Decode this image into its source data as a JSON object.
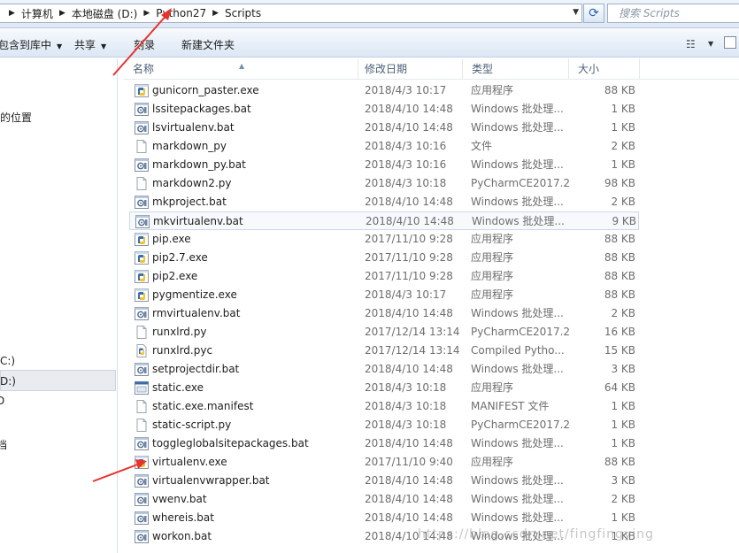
{
  "address": {
    "crumbs": [
      "计算机",
      "本地磁盘 (D:)",
      "Python27",
      "Scripts"
    ]
  },
  "search": {
    "placeholder": "搜索 Scripts"
  },
  "toolbar": {
    "include_library": "包含到库中",
    "share": "共享",
    "burn": "刻录",
    "new_folder": "新建文件夹"
  },
  "nav": {
    "items": [
      "的位置",
      "C:)",
      "D:)",
      "D",
      "档"
    ]
  },
  "columns": {
    "name": "名称",
    "date": "修改日期",
    "type": "类型",
    "size": "大小"
  },
  "files": [
    {
      "name": "gunicorn_paster.exe",
      "date": "2018/4/3 10:17",
      "type": "应用程序",
      "size": "88 KB",
      "icon": "python-exe-icon"
    },
    {
      "name": "lssitepackages.bat",
      "date": "2018/4/10 14:48",
      "type": "Windows 批处理...",
      "size": "1 KB",
      "icon": "bat-icon"
    },
    {
      "name": "lsvirtualenv.bat",
      "date": "2018/4/10 14:48",
      "type": "Windows 批处理...",
      "size": "1 KB",
      "icon": "bat-icon"
    },
    {
      "name": "markdown_py",
      "date": "2018/4/3 10:16",
      "type": "文件",
      "size": "2 KB",
      "icon": "blank-file-icon"
    },
    {
      "name": "markdown_py.bat",
      "date": "2018/4/3 10:16",
      "type": "Windows 批处理...",
      "size": "1 KB",
      "icon": "bat-icon"
    },
    {
      "name": "markdown2.py",
      "date": "2018/4/3 10:18",
      "type": "PyCharmCE2017.2",
      "size": "98 KB",
      "icon": "blank-file-icon"
    },
    {
      "name": "mkproject.bat",
      "date": "2018/4/10 14:48",
      "type": "Windows 批处理...",
      "size": "2 KB",
      "icon": "bat-icon"
    },
    {
      "name": "mkvirtualenv.bat",
      "date": "2018/4/10 14:48",
      "type": "Windows 批处理...",
      "size": "9 KB",
      "icon": "bat-icon"
    },
    {
      "name": "pip.exe",
      "date": "2017/11/10 9:28",
      "type": "应用程序",
      "size": "88 KB",
      "icon": "python-exe-icon"
    },
    {
      "name": "pip2.7.exe",
      "date": "2017/11/10 9:28",
      "type": "应用程序",
      "size": "88 KB",
      "icon": "python-exe-icon"
    },
    {
      "name": "pip2.exe",
      "date": "2017/11/10 9:28",
      "type": "应用程序",
      "size": "88 KB",
      "icon": "python-exe-icon"
    },
    {
      "name": "pygmentize.exe",
      "date": "2018/4/3 10:17",
      "type": "应用程序",
      "size": "88 KB",
      "icon": "python-exe-icon"
    },
    {
      "name": "rmvirtualenv.bat",
      "date": "2018/4/10 14:48",
      "type": "Windows 批处理...",
      "size": "2 KB",
      "icon": "bat-icon"
    },
    {
      "name": "runxlrd.py",
      "date": "2017/12/14 13:14",
      "type": "PyCharmCE2017.2",
      "size": "16 KB",
      "icon": "blank-file-icon"
    },
    {
      "name": "runxlrd.pyc",
      "date": "2017/12/14 13:14",
      "type": "Compiled Pytho...",
      "size": "15 KB",
      "icon": "pyc-icon"
    },
    {
      "name": "setprojectdir.bat",
      "date": "2018/4/10 14:48",
      "type": "Windows 批处理...",
      "size": "3 KB",
      "icon": "bat-icon"
    },
    {
      "name": "static.exe",
      "date": "2018/4/3 10:18",
      "type": "应用程序",
      "size": "64 KB",
      "icon": "window-exe-icon"
    },
    {
      "name": "static.exe.manifest",
      "date": "2018/4/3 10:18",
      "type": "MANIFEST 文件",
      "size": "1 KB",
      "icon": "blank-file-icon"
    },
    {
      "name": "static-script.py",
      "date": "2018/4/3 10:18",
      "type": "PyCharmCE2017.2",
      "size": "1 KB",
      "icon": "blank-file-icon"
    },
    {
      "name": "toggleglobalsitepackages.bat",
      "date": "2018/4/10 14:48",
      "type": "Windows 批处理...",
      "size": "1 KB",
      "icon": "bat-icon"
    },
    {
      "name": "virtualenv.exe",
      "date": "2017/11/10 9:40",
      "type": "应用程序",
      "size": "88 KB",
      "icon": "python-exe-icon"
    },
    {
      "name": "virtualenvwrapper.bat",
      "date": "2018/4/10 14:48",
      "type": "Windows 批处理...",
      "size": "3 KB",
      "icon": "bat-icon"
    },
    {
      "name": "vwenv.bat",
      "date": "2018/4/10 14:48",
      "type": "Windows 批处理...",
      "size": "2 KB",
      "icon": "bat-icon"
    },
    {
      "name": "whereis.bat",
      "date": "2018/4/10 14:48",
      "type": "Windows 批处理...",
      "size": "1 KB",
      "icon": "bat-icon"
    },
    {
      "name": "workon.bat",
      "date": "2018/4/10 14:48",
      "type": "Windows 批处理...",
      "size": "1 KB",
      "icon": "bat-icon"
    }
  ],
  "watermark": "https://blog.csdn.net/fingfingying",
  "colors": {
    "arrow": "#e8322b",
    "selection": "#cbd9ea",
    "accent": "#2a63b8"
  }
}
